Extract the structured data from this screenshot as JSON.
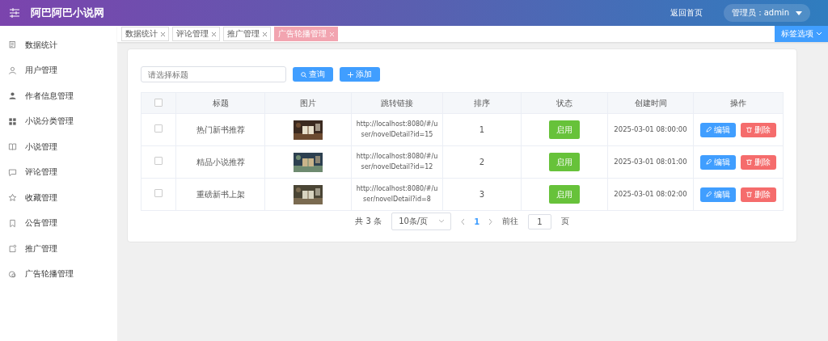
{
  "header": {
    "title": "阿巴阿巴小说网",
    "home_link": "返回首页",
    "user": "管理员：admin"
  },
  "sidebar": {
    "items": [
      {
        "label": "数据统计"
      },
      {
        "label": "用户管理"
      },
      {
        "label": "作者信息管理"
      },
      {
        "label": "小说分类管理"
      },
      {
        "label": "小说管理"
      },
      {
        "label": "评论管理"
      },
      {
        "label": "收藏管理"
      },
      {
        "label": "公告管理"
      },
      {
        "label": "推广管理"
      },
      {
        "label": "广告轮播管理"
      }
    ]
  },
  "tabs": [
    {
      "label": "数据统计",
      "selected": false
    },
    {
      "label": "评论管理",
      "selected": false
    },
    {
      "label": "推广管理",
      "selected": false
    },
    {
      "label": "广告轮播管理",
      "selected": true
    }
  ],
  "tab_options": "标签选项",
  "search": {
    "placeholder": "请选择标题"
  },
  "buttons": {
    "search": "查询",
    "add": "添加"
  },
  "table": {
    "header_checked": false,
    "columns": [
      "标题",
      "图片",
      "跳转链接",
      "排序",
      "状态",
      "创建时间",
      "操作"
    ],
    "rows": [
      {
        "checked": false,
        "title": "热门新书推荐",
        "link": "http://localhost:8080/#/user/novelDetail?id=15",
        "order": "1",
        "status": "启用",
        "enabled": true,
        "created": "2025-03-01 08:00:00",
        "edit": "编辑",
        "delete": "删除"
      },
      {
        "checked": false,
        "title": "精品小说推荐",
        "link": "http://localhost:8080/#/user/novelDetail?id=12",
        "order": "2",
        "status": "启用",
        "enabled": true,
        "created": "2025-03-01 08:01:00",
        "edit": "编辑",
        "delete": "删除"
      },
      {
        "checked": false,
        "title": "重磅新书上架",
        "link": "http://localhost:8080/#/user/novelDetail?id=8",
        "order": "3",
        "status": "启用",
        "enabled": true,
        "created": "2025-03-01 08:02:00",
        "edit": "编辑",
        "delete": "删除"
      }
    ]
  },
  "pagination": {
    "total": "共 3 条",
    "page_size": "10条/页",
    "pages": [
      {
        "label": "1",
        "selected": true
      }
    ],
    "goto_label": "前往",
    "goto_value": "1",
    "page_unit": "页"
  }
}
